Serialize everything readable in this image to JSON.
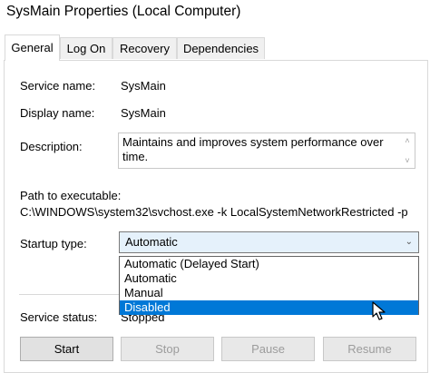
{
  "window": {
    "title": "SysMain Properties (Local Computer)"
  },
  "tabs": [
    {
      "label": "General",
      "active": true
    },
    {
      "label": "Log On",
      "active": false
    },
    {
      "label": "Recovery",
      "active": false
    },
    {
      "label": "Dependencies",
      "active": false
    }
  ],
  "general": {
    "service_name_label": "Service name:",
    "service_name_value": "SysMain",
    "display_name_label": "Display name:",
    "display_name_value": "SysMain",
    "description_label": "Description:",
    "description_value": "Maintains and improves system performance over time.",
    "path_label": "Path to executable:",
    "path_value": "C:\\WINDOWS\\system32\\svchost.exe -k LocalSystemNetworkRestricted -p",
    "startup_type_label": "Startup type:",
    "startup_type_value": "Automatic",
    "startup_options": [
      "Automatic (Delayed Start)",
      "Automatic",
      "Manual",
      "Disabled"
    ],
    "highlighted_option": "Disabled",
    "service_status_label": "Service status:",
    "service_status_value": "Stopped"
  },
  "buttons": {
    "start": "Start",
    "stop": "Stop",
    "pause": "Pause",
    "resume": "Resume"
  },
  "colors": {
    "highlight": "#0078d7",
    "combo_background": "#e5f1fb",
    "disabled_text": "#9c9c9c"
  }
}
